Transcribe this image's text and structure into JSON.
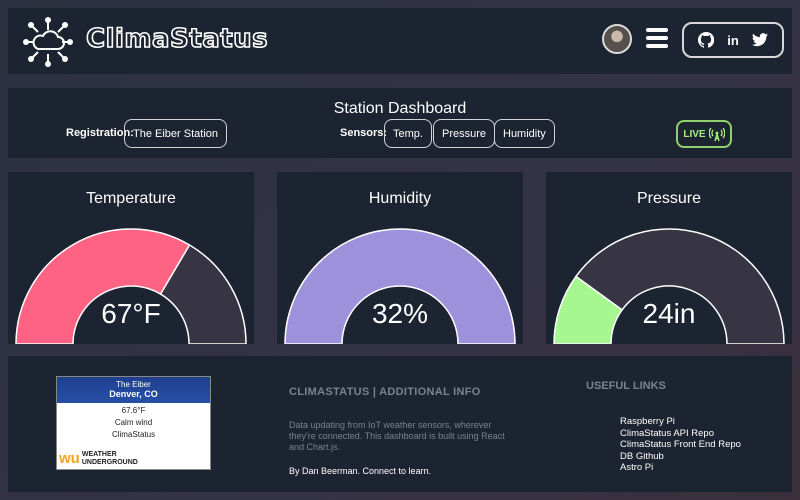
{
  "header": {
    "brand": "ClimaStatus",
    "social": {
      "github": "GH",
      "linkedin": "in",
      "twitter": "tw"
    }
  },
  "station": {
    "title": "Station Dashboard",
    "registration_label": "Registration:",
    "registration_value": "The Eiber Station",
    "sensors_label": "Sensors:",
    "sensors": [
      "Temp.",
      "Pressure",
      "Humidity"
    ],
    "live_label": "LIVE"
  },
  "gauges": [
    {
      "title": "Temperature",
      "value": "67°F",
      "fraction": 0.67,
      "fill": "#ff6383",
      "empty": "#373443"
    },
    {
      "title": "Humidity",
      "value": "32%",
      "fraction": 1.0,
      "fill": "#9d91dc",
      "empty": "#373443"
    },
    {
      "title": "Pressure",
      "value": "24in",
      "fraction": 0.2,
      "fill": "#a6f78f",
      "empty": "#373443"
    }
  ],
  "widget": {
    "station": "The Eiber",
    "location": "Denver, CO",
    "temp": "67.6°F",
    "wind": "Calm wind",
    "source": "ClimaStatus",
    "brand_line1": "WEATHER",
    "brand_line2": "UNDERGROUND"
  },
  "info": {
    "title": "CLIMASTATUS | ADDITIONAL INFO",
    "body": "Data updating from IoT weather sensors, wherever they're connected. This dashboard is built using React and Chart.js.",
    "author": "By Dan Beerman. Connect to learn."
  },
  "links": {
    "title": "USEFUL LINKS",
    "items": [
      "Raspberry Pi",
      "ClimaStatus API Repo",
      "ClimaStatus Front End Repo",
      "DB Github",
      "Astro Pi"
    ]
  }
}
